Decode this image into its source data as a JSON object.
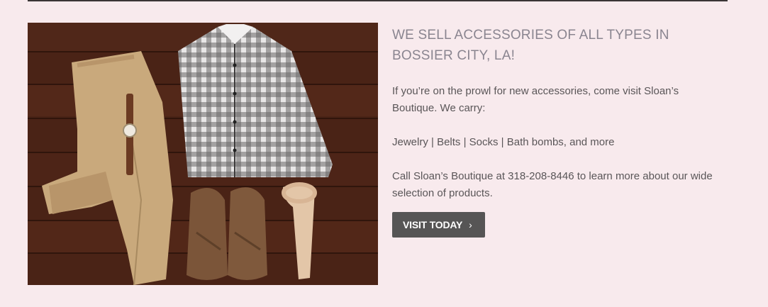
{
  "section": {
    "heading": "WE SELL ACCESSORIES OF ALL TYPES IN BOSSIER CITY, LA!",
    "intro": "If you’re on the prowl for new accessories, come visit Sloan’s Boutique. We carry:",
    "items_line": "Jewelry | Belts | Socks | Bath bombs, and more",
    "contact": "Call Sloan’s Boutique at 318-208-8446 to learn more about our wide selection of products.",
    "cta_label": "VISIT TODAY",
    "cta_icon": "chevron-right-icon",
    "image_icon": "flatlay-clothing-photo"
  },
  "colors": {
    "background": "#f8eaed",
    "heading": "#8a8590",
    "body_text": "#5a5658",
    "button": "#565555",
    "button_text": "#ffffff",
    "rule": "#3a3535"
  }
}
